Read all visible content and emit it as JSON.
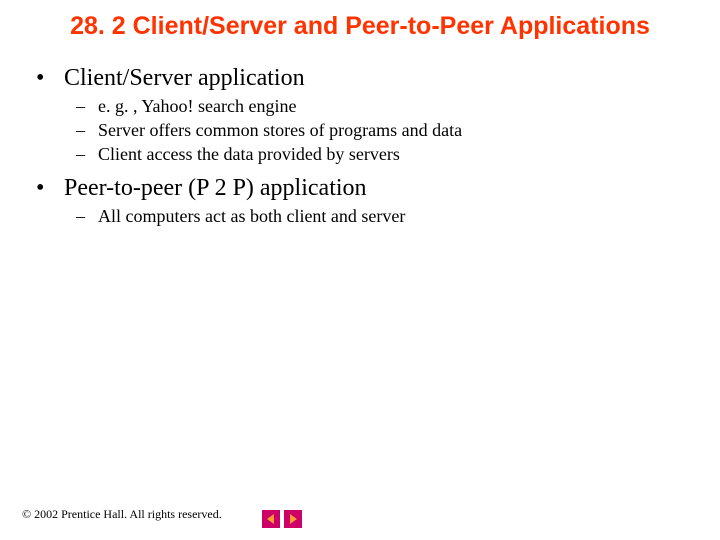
{
  "title": "28. 2   Client/Server and Peer-to-Peer Applications",
  "bullets": [
    {
      "text": "Client/Server application",
      "sub": [
        "e. g. , Yahoo! search engine",
        "Server offers common stores of programs and data",
        "Client access the data provided by servers"
      ]
    },
    {
      "text": "Peer-to-peer (P 2 P) application",
      "sub": [
        "All computers act as both client and server"
      ]
    }
  ],
  "footer": "© 2002 Prentice Hall. All rights reserved.",
  "nav": {
    "prev": "previous-slide",
    "next": "next-slide"
  }
}
